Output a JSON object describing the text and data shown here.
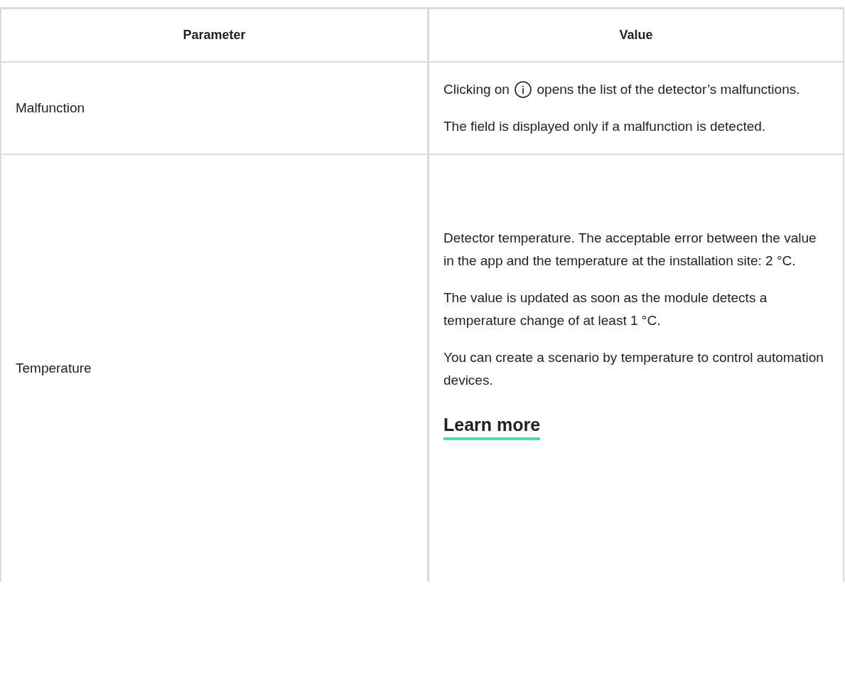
{
  "table": {
    "columns": [
      "Parameter",
      "Value"
    ],
    "rows": [
      {
        "parameter": "Malfunction",
        "value": [
          {
            "kind": "icon_text",
            "before": "Clicking on",
            "after": "opens the list of the detector’s malfunctions."
          },
          {
            "kind": "text",
            "text": "The field is displayed only if a malfunction is detected."
          }
        ]
      },
      {
        "parameter": "Temperature",
        "value": [
          {
            "kind": "text",
            "text": "Detector temperature. The acceptable error between the value in the app and the temperature at the installation site: 2 °C."
          },
          {
            "kind": "text",
            "text": "The value is updated as soon as the module detects a temperature change of at least 1 °C."
          },
          {
            "kind": "text",
            "text": "You can create a scenario by temperature to control automation devices."
          },
          {
            "kind": "link",
            "text": "Learn more"
          }
        ]
      }
    ]
  }
}
